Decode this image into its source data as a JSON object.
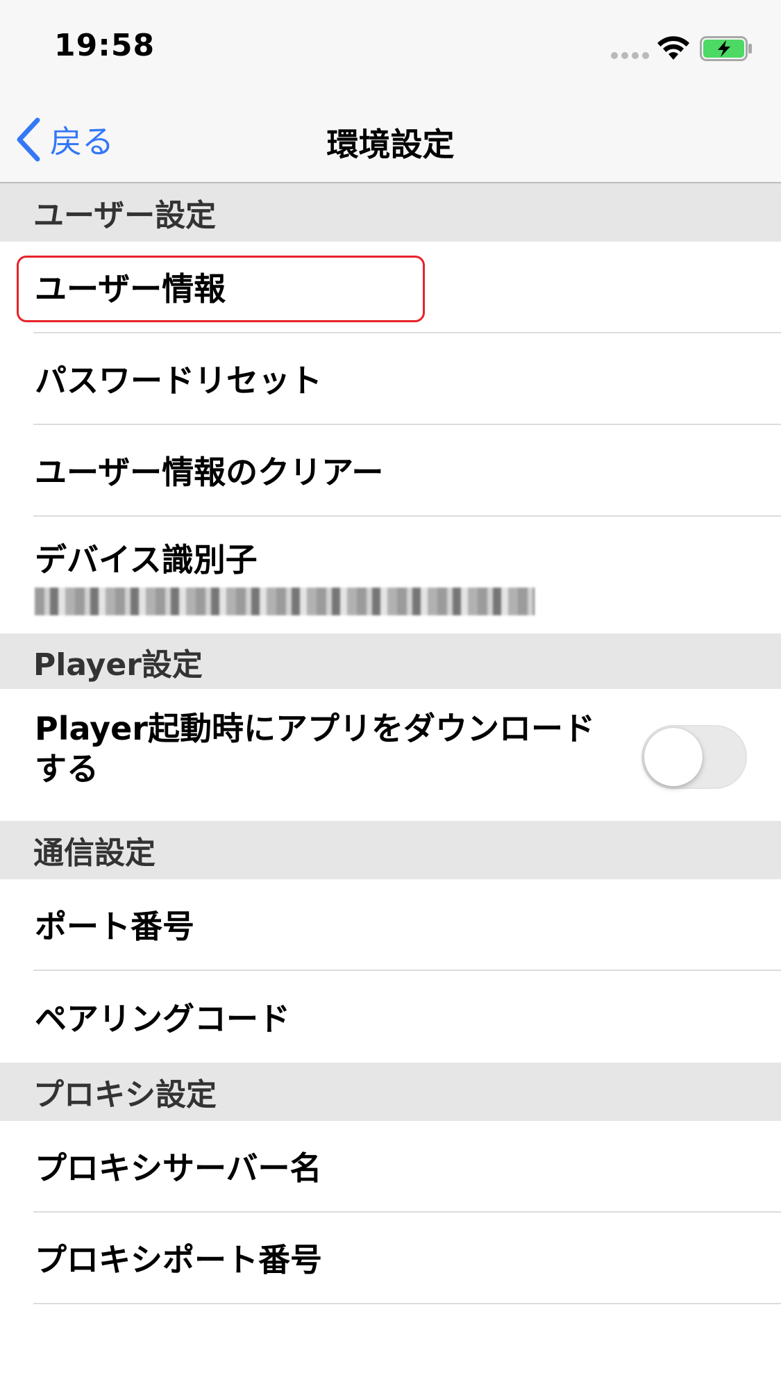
{
  "status_bar": {
    "time": "19:58",
    "icons": [
      "signal-dots-icon",
      "wifi-icon",
      "battery-charging-icon"
    ],
    "battery_color": "#4cd964"
  },
  "nav": {
    "back_label": "戻る",
    "title": "環境設定",
    "accent_color": "#3478f6"
  },
  "sections": {
    "user": {
      "header": "ユーザー設定",
      "items": {
        "user_info": "ユーザー情報",
        "password_reset": "パスワードリセット",
        "clear_user_info": "ユーザー情報のクリアー",
        "device_id_label": "デバイス識別子",
        "device_id_value": "xxxxxxxx-xxxx-xxxx-xxxx-xxxxxxxxxxxx"
      }
    },
    "player": {
      "header": "Player設定",
      "download_on_launch_label": "Player起動時にアプリをダウンロードする",
      "download_on_launch_enabled": false
    },
    "network": {
      "header": "通信設定",
      "items": {
        "port_number": "ポート番号",
        "pairing_code": "ペアリングコード"
      }
    },
    "proxy": {
      "header": "プロキシ設定",
      "items": {
        "proxy_server_name": "プロキシサーバー名",
        "proxy_port_number": "プロキシポート番号"
      }
    }
  },
  "highlight_color": "#e8222a"
}
